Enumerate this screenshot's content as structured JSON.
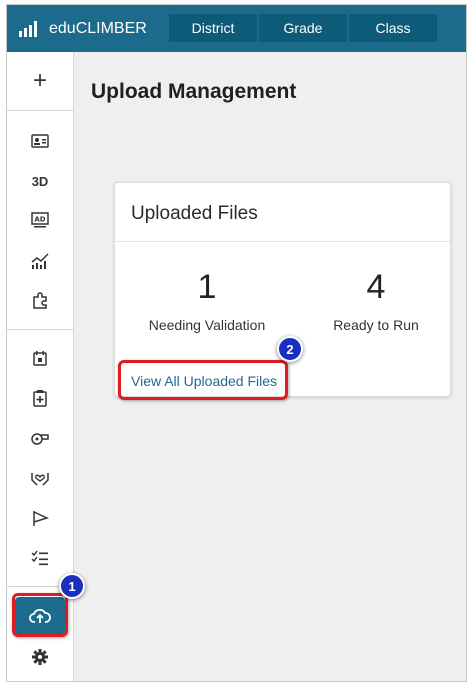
{
  "app": {
    "brand": "eduCLIMBER"
  },
  "nav": {
    "tabs": [
      "District",
      "Grade",
      "Class"
    ]
  },
  "sidebar": {
    "add_label": "+",
    "three_d_label": "3D",
    "items": [
      {
        "icon": "id-card-icon"
      },
      {
        "icon": "3d-text"
      },
      {
        "icon": "ad-screen-icon"
      },
      {
        "icon": "chart-trend-icon"
      },
      {
        "icon": "puzzle-icon"
      },
      {
        "icon": "calendar-icon"
      },
      {
        "icon": "clipboard-plus-icon"
      },
      {
        "icon": "whistle-icon"
      },
      {
        "icon": "hands-heart-icon"
      },
      {
        "icon": "flag-icon"
      },
      {
        "icon": "checklist-icon"
      },
      {
        "icon": "cloud-upload-icon"
      },
      {
        "icon": "gear-icon"
      }
    ]
  },
  "page": {
    "title": "Upload Management"
  },
  "card": {
    "title": "Uploaded Files",
    "stats": [
      {
        "value": "1",
        "label": "Needing Validation"
      },
      {
        "value": "4",
        "label": "Ready to Run"
      }
    ],
    "link": "View All Uploaded Files"
  },
  "callouts": [
    "1",
    "2"
  ],
  "colors": {
    "brand": "#1d6b8c",
    "highlight": "#e21b23",
    "step": "#1a2fbf"
  }
}
